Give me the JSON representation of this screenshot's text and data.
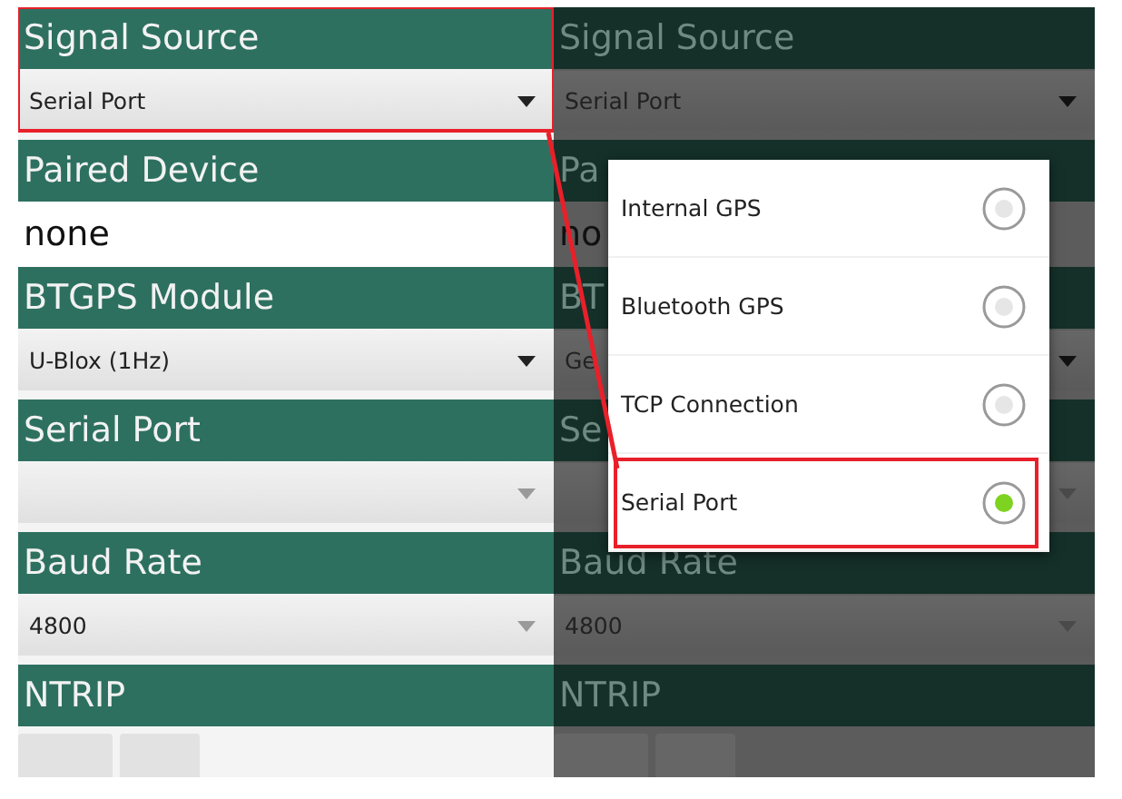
{
  "left_panel": {
    "dimmed": false,
    "sections": [
      {
        "kind": "spinner",
        "header": "Signal Source",
        "value": "Serial Port",
        "enabled": true,
        "highlighted": true
      },
      {
        "kind": "text",
        "header": "Paired Device",
        "value": "none"
      },
      {
        "kind": "spinner",
        "header": "BTGPS Module",
        "value": "U-Blox (1Hz)",
        "enabled": true
      },
      {
        "kind": "spinner",
        "header": "Serial Port",
        "enabled": false
      },
      {
        "kind": "spinner",
        "header": "Baud Rate",
        "value": "4800",
        "enabled": false
      },
      {
        "kind": "buttons",
        "header": "NTRIP"
      }
    ]
  },
  "right_panel": {
    "dimmed": true,
    "sections": [
      {
        "kind": "spinner",
        "header": "Signal Source",
        "value": "Serial Port",
        "enabled": true
      },
      {
        "kind": "text",
        "header": "Pa",
        "value": "no"
      },
      {
        "kind": "spinner",
        "header": "BT",
        "value": "Ge",
        "enabled": true
      },
      {
        "kind": "spinner",
        "header": "Se",
        "enabled": false
      },
      {
        "kind": "spinner",
        "header": "Baud Rate",
        "value": "4800",
        "enabled": false
      },
      {
        "kind": "buttons",
        "header": "NTRIP"
      }
    ]
  },
  "dialog": {
    "options": [
      {
        "label": "Internal GPS",
        "selected": false,
        "highlighted": false
      },
      {
        "label": "Bluetooth GPS",
        "selected": false,
        "highlighted": false
      },
      {
        "label": "TCP Connection",
        "selected": false,
        "highlighted": false
      },
      {
        "label": "Serial Port",
        "selected": true,
        "highlighted": true
      }
    ]
  }
}
